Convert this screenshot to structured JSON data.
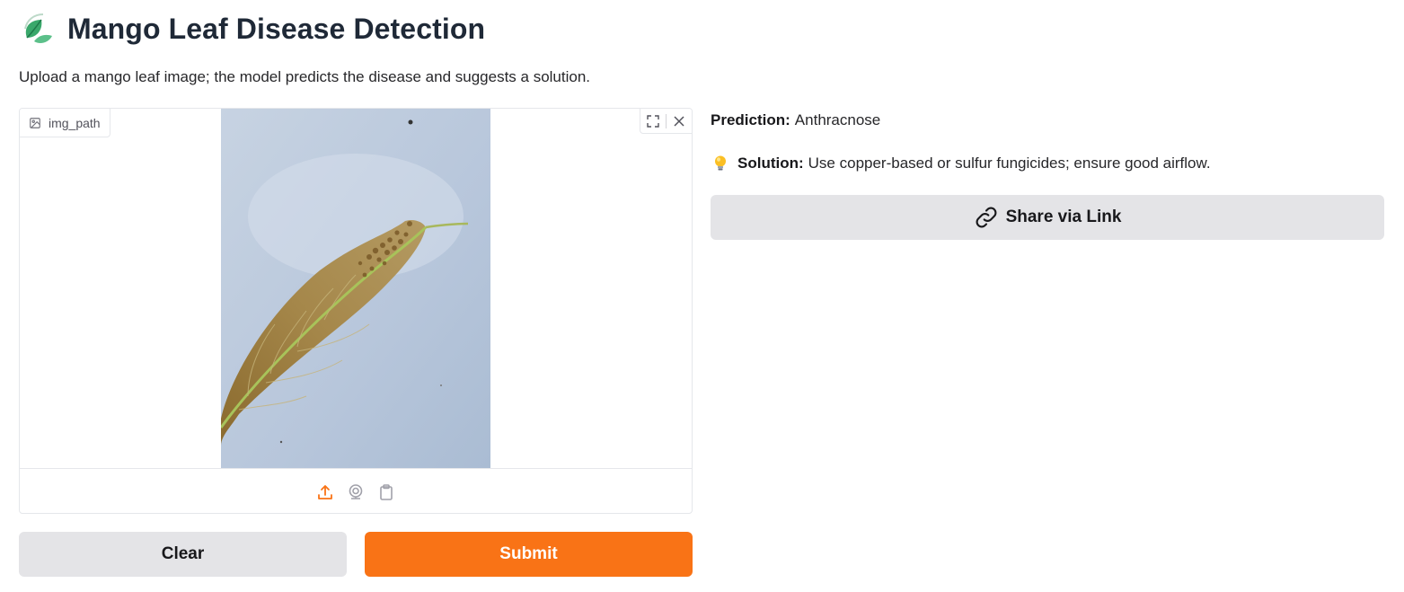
{
  "header": {
    "title": "Mango Leaf Disease Detection",
    "logo_icon": "leaf-icon",
    "description": "Upload a mango leaf image; the model predicts the disease and suggests a solution."
  },
  "input_image": {
    "label": "img_path",
    "label_icon": "image-icon",
    "controls": [
      "fullscreen-icon",
      "close-icon"
    ],
    "sources": [
      "upload-icon",
      "webcam-icon",
      "clipboard-icon"
    ],
    "active_source": "upload-icon"
  },
  "actions": {
    "clear_label": "Clear",
    "submit_label": "Submit"
  },
  "output": {
    "prediction_label": "Prediction:",
    "prediction_value": "Anthracnose",
    "solution_icon": "lightbulb-icon",
    "solution_label": "Solution:",
    "solution_value": "Use copper-based or sulfur fungicides; ensure good airflow.",
    "share_label": "Share via Link",
    "share_icon": "link-icon"
  },
  "colors": {
    "accent": "#f97316",
    "secondary_button": "#e4e4e7",
    "text": "#1f2937"
  }
}
